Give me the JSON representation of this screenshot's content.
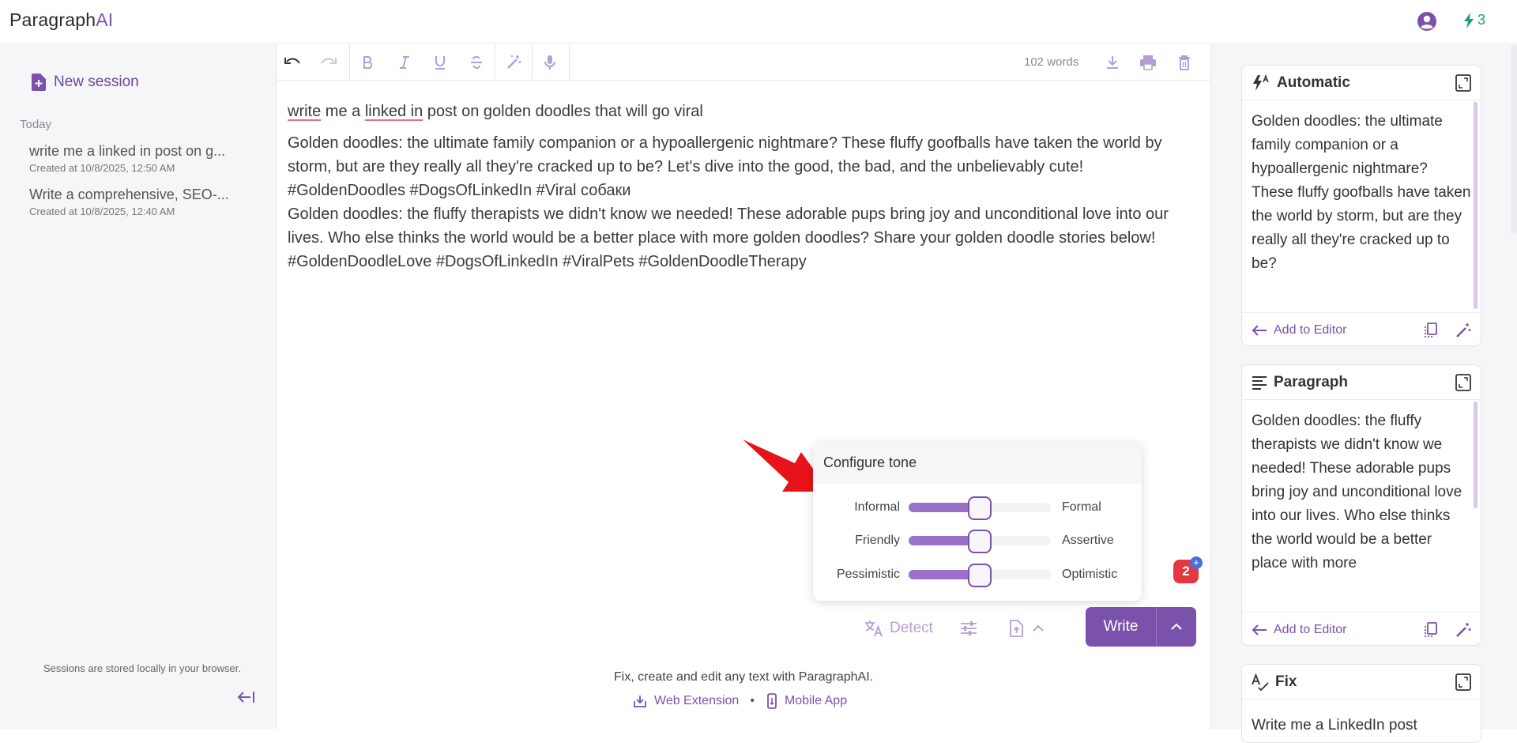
{
  "app": {
    "logo_prefix": "Paragraph",
    "logo_suffix": "AI",
    "credits": "3"
  },
  "sidebar": {
    "new_session": "New session",
    "group_label": "Today",
    "sessions": [
      {
        "title": "write me a linked in post on g...",
        "created": "Created at 10/8/2025, 12:50 AM"
      },
      {
        "title": "Write a comprehensive, SEO-...",
        "created": "Created at 10/8/2025, 12:40 AM"
      }
    ],
    "storage_note": "Sessions are stored locally in your browser."
  },
  "editor": {
    "word_count": "102 words",
    "prompt_pre": "write",
    "prompt_mid": " me a ",
    "prompt_link": "linked in",
    "prompt_post": " post on golden doodles that will go viral",
    "paragraph1": "Golden doodles: the ultimate family companion or a hypoallergenic nightmare? These fluffy goofballs have taken the world by storm, but are they really all they're cracked up to be? Let's dive into the good, the bad, and the unbelievably cute! #GoldenDoodles #DogsOfLinkedIn #Viral собаки",
    "paragraph2": "Golden doodles: the fluffy therapists we didn't know we needed! These adorable pups bring joy and unconditional love into our lives. Who else thinks the world would be a better place with more golden doodles? Share your golden doodle stories below! #GoldenDoodleLove #DogsOfLinkedIn #ViralPets #GoldenDoodleTherapy"
  },
  "tone": {
    "title": "Configure tone",
    "rows": [
      {
        "left": "Informal",
        "right": "Formal",
        "value": 0.5
      },
      {
        "left": "Friendly",
        "right": "Assertive",
        "value": 0.5
      },
      {
        "left": "Pessimistic",
        "right": "Optimistic",
        "value": 0.5
      }
    ]
  },
  "badge": {
    "count": "2",
    "plus": "+"
  },
  "actions": {
    "detect": "Detect",
    "write": "Write"
  },
  "footer": {
    "tagline": "Fix, create and edit any text with ParagraphAI.",
    "web_extension": "Web Extension",
    "separator": "•",
    "mobile_app": "Mobile App"
  },
  "cards": [
    {
      "title": "Automatic",
      "body": "Golden doodles: the ultimate family companion or a hypoallergenic nightmare? These fluffy goofballs have taken the world by storm, but are they really all they're cracked up to be?",
      "add": "Add to Editor"
    },
    {
      "title": "Paragraph",
      "body": "Golden doodles: the fluffy therapists we didn't know we needed! These adorable pups bring joy and unconditional love into our lives. Who else thinks the world would be a better place with more",
      "add": "Add to Editor"
    },
    {
      "title": "Fix",
      "body": "Write me a LinkedIn post"
    }
  ],
  "colors": {
    "accent": "#7b52ab",
    "credit": "#19a07a",
    "badge": "#e53740"
  }
}
